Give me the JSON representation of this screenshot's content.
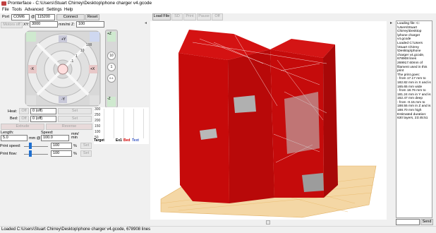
{
  "window": {
    "title": "Pronterface - C:\\Users\\Stuart Chirrey\\Desktop\\phone charger v4.gcode"
  },
  "menu": [
    "File",
    "Tools",
    "Advanced",
    "Settings",
    "Help"
  ],
  "connection": {
    "port_label": "Port",
    "port_value": "COM6",
    "at_label": "@",
    "baud_value": "115200",
    "connect_label": "Connect",
    "reset_label": "Reset"
  },
  "motors": {
    "motors_off_label": "Motors off",
    "xy_label": "XY:",
    "xy_value": "3000",
    "mm_label": "mm/mi Z:",
    "z_value": "100"
  },
  "jog": {
    "plus_y": "+Y",
    "minus_y": "-Y",
    "plus_x": "+X",
    "minus_x": "-X",
    "plus_z": "+Z",
    "minus_z": "-Z",
    "rings": [
      "100",
      "10",
      "1",
      ".1"
    ],
    "z_steps": [
      "10",
      "1",
      "0.1"
    ]
  },
  "heat": {
    "heat_label": "Heat:",
    "heat_off": "Off",
    "heat_select": "0 (off)",
    "heat_set": "Set",
    "bed_label": "Bed:",
    "bed_off": "Off",
    "bed_select": "0 (off)",
    "bed_set": "Set"
  },
  "extrude": {
    "extrude_label": "Extrude",
    "reverse_label": "Reverse"
  },
  "length": {
    "length_label": "Length:",
    "length_value": "5.0",
    "length_unit": "mm @",
    "speed_label": "Speed:",
    "speed_value": "100.0",
    "speed_unit": "mm/ min"
  },
  "print_speed": {
    "label": "Print speed:",
    "value": "100",
    "unit": "%",
    "set": "Set"
  },
  "print_flow": {
    "label": "Print flow:",
    "value": "100",
    "unit": "%",
    "set": "Set"
  },
  "temp_graph": {
    "ticks": [
      "300",
      "250",
      "200",
      "150",
      "100",
      "50"
    ],
    "legend_target": "Target",
    "legend_ex1": "Ex1",
    "legend_bed": "Bed",
    "legend_text": "Text"
  },
  "view_toolbar": [
    "Load File",
    "SD",
    "Print",
    "Pause",
    "Off"
  ],
  "log_lines": [
    "Loading file: C:",
    "\\Users\\Stuart",
    "Chirrey\\Desktop",
    "\\phone charger",
    "v4.gcode",
    "Loaded C:\\Users",
    "\\Stuart Chirrey",
    "\\Desktop\\phone",
    "charger v4.gcode,",
    "678908 lines",
    "269917.60mm of",
    "filament used in this",
    "print",
    "The print goes:",
    "- from 17.17 mm to",
    "182.82 mm in X and is",
    "165.65 mm wide",
    "- from 18.76 mm to",
    "181.24 mm in Y and is",
    "162.47 mm deep",
    "- from -0.15 mm to",
    "188.55 mm in Z and is",
    "188.70 mm high",
    "Estimated duration:",
    "630 layers, 23:45:51"
  ],
  "send_label": "Send",
  "status": "Loaded C:\\Users\\Stuart Chirrey\\Desktop\\phone charger v4.gcode, 678908 lines",
  "colors": {
    "model_red": "#cc0b0b",
    "bed_orange": "#e8b060",
    "panel_bg": "#f0f0f0"
  }
}
